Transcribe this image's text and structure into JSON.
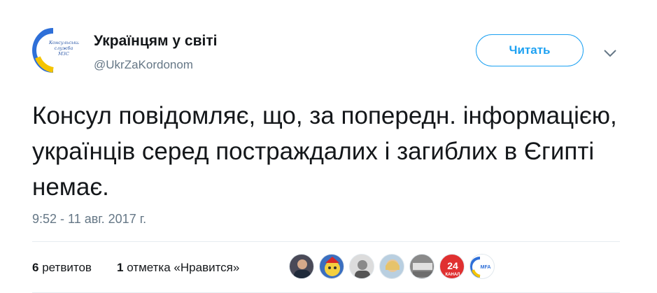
{
  "account": {
    "name": "Українцям у світі",
    "handle": "@UkrZaKordonom",
    "avatar_label_lines": [
      "Консульська",
      "служба",
      "МЗС"
    ]
  },
  "follow_button": {
    "label": "Читать",
    "color": "#1da1f2"
  },
  "tweet": {
    "text": "Консул повідомляє, що, за попередн. інформацією, українців серед постраждалих і загиблих в Єгипті немає.",
    "timestamp": "9:52 - 11 авг. 2017 г."
  },
  "stats": {
    "retweets_count": "6",
    "retweets_label": "ретвитов",
    "likes_count": "1",
    "likes_label": "отметка «Нравится»"
  },
  "likers_badges": {
    "tv_channel_number": "24",
    "tv_channel_word": "КАНАЛ",
    "mfa_text": "MFA"
  },
  "colors": {
    "text_primary": "#14171a",
    "text_secondary": "#657786",
    "divider": "#e6ecf0"
  }
}
